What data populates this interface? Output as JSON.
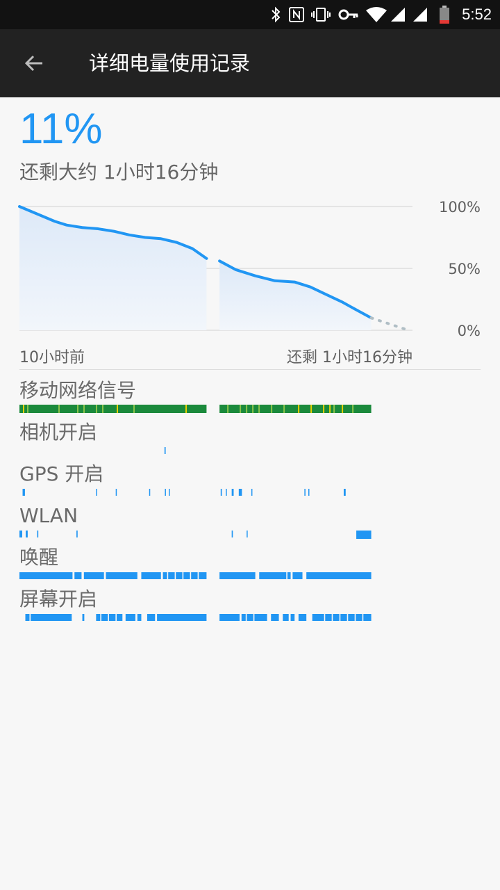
{
  "status_bar": {
    "time": "5:52",
    "icons": [
      "bluetooth-icon",
      "nfc-icon",
      "vibrate-icon",
      "vpn-key-icon",
      "wifi-icon",
      "signal-icon",
      "signal-icon",
      "battery-low-icon"
    ]
  },
  "app_bar": {
    "title": "详细电量使用记录",
    "back_icon": "back-arrow-icon"
  },
  "battery": {
    "percent": "11%",
    "remaining": "还剩大约 1小时16分钟"
  },
  "chart_data": {
    "type": "area",
    "x_label_start": "10小时前",
    "x_label_end": "还剩 1小时16分钟",
    "y_ticks": [
      "100%",
      "50%",
      "0%"
    ],
    "ylim": [
      0,
      100
    ],
    "gap_between": [
      0.476,
      0.509
    ],
    "series": [
      {
        "values": [
          [
            0.0,
            100
          ],
          [
            0.03,
            96
          ],
          [
            0.06,
            92
          ],
          [
            0.09,
            88
          ],
          [
            0.12,
            85
          ],
          [
            0.16,
            83
          ],
          [
            0.2,
            82
          ],
          [
            0.24,
            80
          ],
          [
            0.28,
            77
          ],
          [
            0.32,
            75
          ],
          [
            0.36,
            74
          ],
          [
            0.4,
            71
          ],
          [
            0.44,
            66
          ],
          [
            0.476,
            58
          ]
        ]
      },
      {
        "values": [
          [
            0.509,
            56
          ],
          [
            0.55,
            49
          ],
          [
            0.6,
            44
          ],
          [
            0.65,
            40
          ],
          [
            0.7,
            39
          ],
          [
            0.74,
            35
          ],
          [
            0.78,
            29
          ],
          [
            0.82,
            23
          ],
          [
            0.86,
            16
          ],
          [
            0.895,
            10
          ]
        ]
      }
    ],
    "projection": [
      [
        0.895,
        10
      ],
      [
        0.99,
        0
      ]
    ],
    "colors": {
      "line": "#2196f3",
      "fill": "#dde9f8",
      "grid": "#dddddd",
      "projection": "#b0bec5"
    }
  },
  "tracks": [
    {
      "label": "移动网络信号",
      "kind": "signal",
      "segments": [
        [
          0.0,
          0.476
        ],
        [
          0.509,
          0.895
        ]
      ],
      "colors": {
        "base": "#1b8a3c",
        "accent": "#8bc34a",
        "warn": "#e6d000"
      }
    },
    {
      "label": "相机开启",
      "kind": "events",
      "color": "#2196f3",
      "events": [
        [
          0.369,
          0.372
        ]
      ]
    },
    {
      "label": "GPS 开启",
      "kind": "events",
      "color": "#2196f3",
      "events": [
        [
          0.008,
          0.014
        ],
        [
          0.195,
          0.197
        ],
        [
          0.245,
          0.247
        ],
        [
          0.33,
          0.332
        ],
        [
          0.37,
          0.372
        ],
        [
          0.38,
          0.382
        ],
        [
          0.512,
          0.515
        ],
        [
          0.525,
          0.527
        ],
        [
          0.54,
          0.545
        ],
        [
          0.558,
          0.566
        ],
        [
          0.59,
          0.592
        ],
        [
          0.725,
          0.727
        ],
        [
          0.735,
          0.737
        ],
        [
          0.825,
          0.83
        ]
      ]
    },
    {
      "label": "WLAN",
      "kind": "events",
      "color": "#2196f3",
      "events": [
        [
          0.0,
          0.007
        ],
        [
          0.016,
          0.021
        ],
        [
          0.045,
          0.048
        ],
        [
          0.145,
          0.148
        ],
        [
          0.54,
          0.543
        ],
        [
          0.578,
          0.58
        ],
        [
          0.857,
          0.895
        ]
      ]
    },
    {
      "label": "唤醒",
      "kind": "events",
      "color": "#2196f3",
      "events": [
        [
          0.0,
          0.135
        ],
        [
          0.14,
          0.158
        ],
        [
          0.164,
          0.215
        ],
        [
          0.22,
          0.3
        ],
        [
          0.31,
          0.36
        ],
        [
          0.365,
          0.476
        ],
        [
          0.509,
          0.6
        ],
        [
          0.61,
          0.69
        ],
        [
          0.695,
          0.72
        ],
        [
          0.73,
          0.895
        ]
      ]
    },
    {
      "label": "屏幕开启",
      "kind": "events",
      "color": "#2196f3",
      "events": [
        [
          0.015,
          0.133
        ],
        [
          0.16,
          0.165
        ],
        [
          0.195,
          0.262
        ],
        [
          0.27,
          0.295
        ],
        [
          0.3,
          0.31
        ],
        [
          0.325,
          0.345
        ],
        [
          0.35,
          0.476
        ],
        [
          0.509,
          0.56
        ],
        [
          0.565,
          0.63
        ],
        [
          0.64,
          0.66
        ],
        [
          0.67,
          0.685
        ],
        [
          0.69,
          0.7
        ],
        [
          0.71,
          0.73
        ],
        [
          0.745,
          0.895
        ]
      ]
    }
  ]
}
